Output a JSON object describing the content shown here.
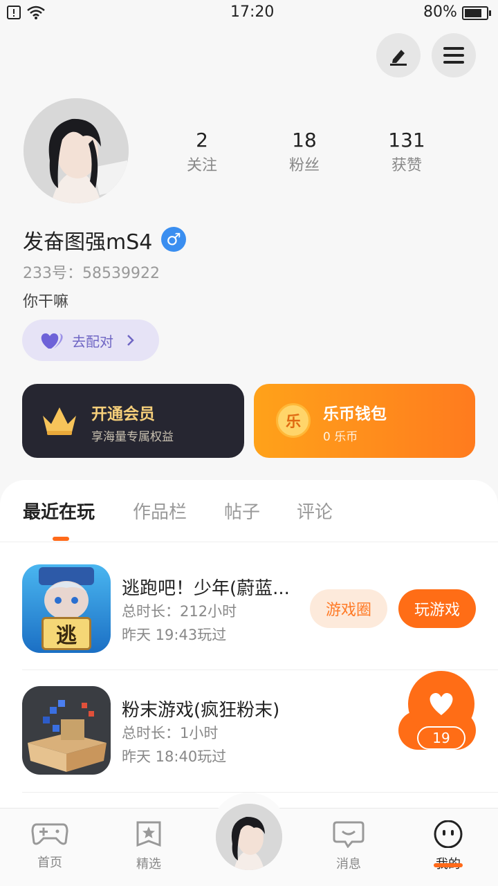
{
  "status_bar": {
    "time": "17:20",
    "battery": "80%"
  },
  "profile": {
    "stats": [
      {
        "value": "2",
        "label": "关注"
      },
      {
        "value": "18",
        "label": "粉丝"
      },
      {
        "value": "131",
        "label": "获赞"
      }
    ],
    "name": "发奋图强mS4",
    "gender_symbol": "♂",
    "uid": "233号：58539922",
    "bio": "你干嘛",
    "match_label": "去配对"
  },
  "cards": {
    "vip": {
      "title": "开通会员",
      "subtitle": "享海量专属权益"
    },
    "wallet": {
      "title": "乐币钱包",
      "subtitle": "0 乐币",
      "coin_char": "乐"
    }
  },
  "tabs": [
    "最近在玩",
    "作品栏",
    "帖子",
    "评论"
  ],
  "games": [
    {
      "title": "逃跑吧！少年(蔚蓝...",
      "duration": "总时长：212小时",
      "last_played": "昨天 19:43玩过",
      "icon_char": "逃",
      "btn_circle": "游戏圈",
      "btn_play": "玩游戏"
    },
    {
      "title": "粉末游戏(疯狂粉末)",
      "duration": "总时长：1小时",
      "last_played": "昨天 18:40玩过"
    }
  ],
  "floating_like": {
    "count": "19"
  },
  "bottom_nav": [
    {
      "label": "首页"
    },
    {
      "label": "精选"
    },
    {
      "label": "消息"
    },
    {
      "label": "我的"
    }
  ],
  "colors": {
    "accent": "#ff6d16",
    "vip_bg": "#262631",
    "gender_blue": "#3a8ef0"
  }
}
